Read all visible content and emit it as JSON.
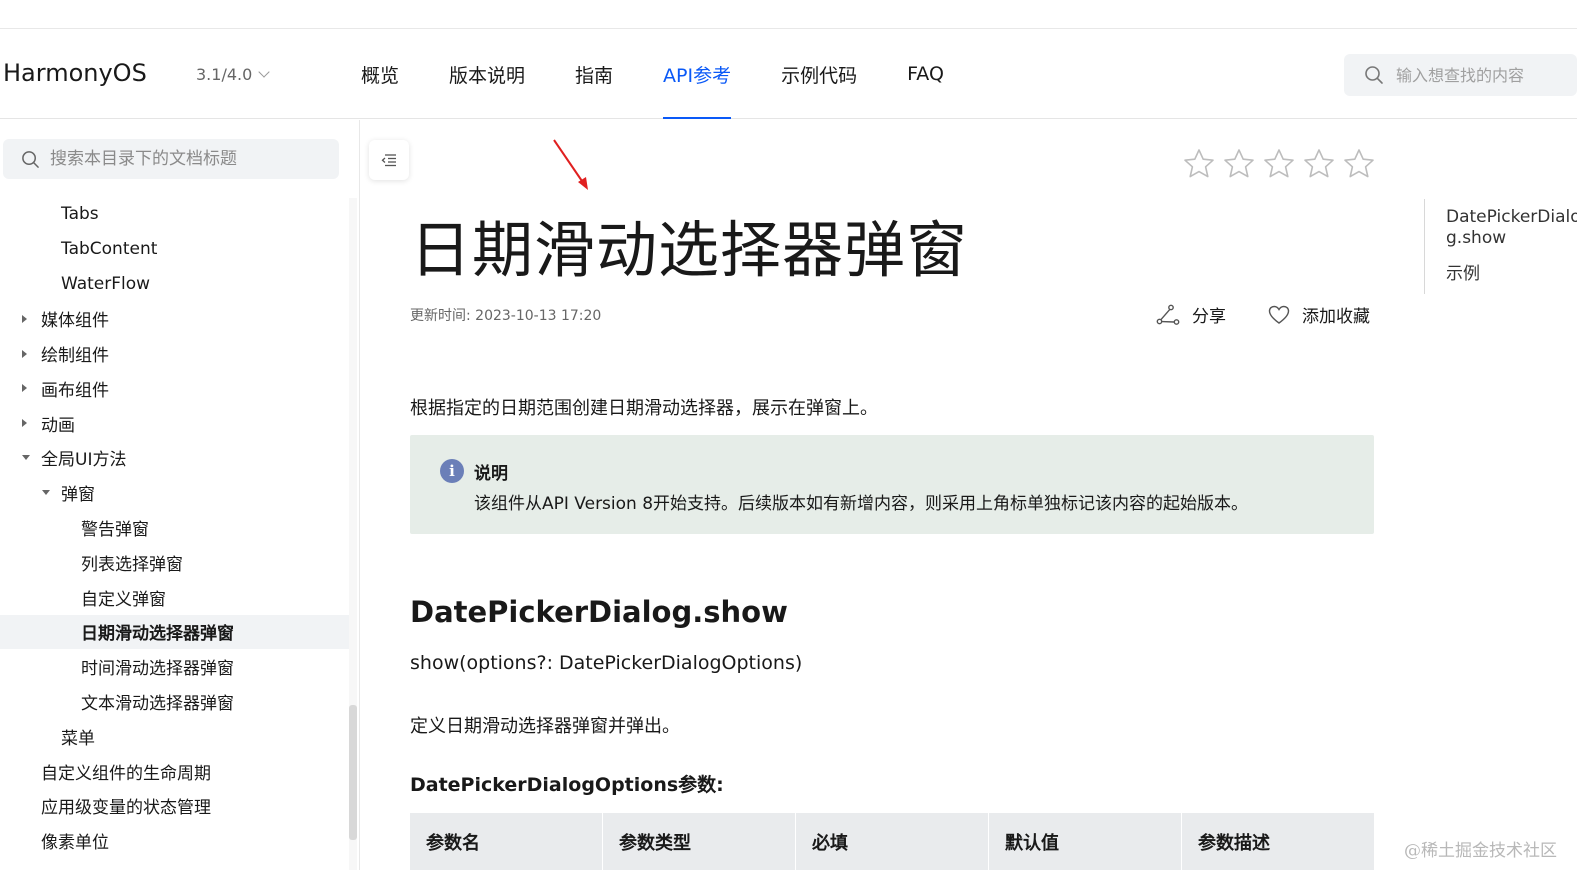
{
  "header": {
    "brand": "HarmonyOS",
    "version": "3.1/4.0",
    "nav": [
      "概览",
      "版本说明",
      "指南",
      "API参考",
      "示例代码",
      "FAQ"
    ],
    "active_nav": "API参考",
    "search_placeholder": "输入想查找的内容"
  },
  "sidebar": {
    "search_placeholder": "搜索本目录下的文档标题",
    "items": [
      {
        "label": "Tabs",
        "level": 2,
        "toggle": "none"
      },
      {
        "label": "TabContent",
        "level": 2,
        "toggle": "none"
      },
      {
        "label": "WaterFlow",
        "level": 2,
        "toggle": "none"
      },
      {
        "label": "媒体组件",
        "level": 1,
        "toggle": "collapsed"
      },
      {
        "label": "绘制组件",
        "level": 1,
        "toggle": "collapsed"
      },
      {
        "label": "画布组件",
        "level": 1,
        "toggle": "collapsed"
      },
      {
        "label": "动画",
        "level": 1,
        "toggle": "collapsed"
      },
      {
        "label": "全局UI方法",
        "level": 1,
        "toggle": "expanded"
      },
      {
        "label": "弹窗",
        "level": 2,
        "toggle": "expanded"
      },
      {
        "label": "警告弹窗",
        "level": 3,
        "toggle": "none"
      },
      {
        "label": "列表选择弹窗",
        "level": 3,
        "toggle": "none"
      },
      {
        "label": "自定义弹窗",
        "level": 3,
        "toggle": "none"
      },
      {
        "label": "日期滑动选择器弹窗",
        "level": 3,
        "toggle": "none",
        "active": true
      },
      {
        "label": "时间滑动选择器弹窗",
        "level": 3,
        "toggle": "none"
      },
      {
        "label": "文本滑动选择器弹窗",
        "level": 3,
        "toggle": "none"
      },
      {
        "label": "菜单",
        "level": 2,
        "toggle": "none"
      },
      {
        "label": "自定义组件的生命周期",
        "level": 1,
        "toggle": "none"
      },
      {
        "label": "应用级变量的状态管理",
        "level": 1,
        "toggle": "none"
      },
      {
        "label": "像素单位",
        "level": 1,
        "toggle": "none"
      }
    ]
  },
  "main": {
    "title": "日期滑动选择器弹窗",
    "updated": "更新时间: 2023-10-13 17:20",
    "share_label": "分享",
    "favorite_label": "添加收藏",
    "intro": "根据指定的日期范围创建日期滑动选择器，展示在弹窗上。",
    "note_title": "说明",
    "note_icon": "i",
    "note_text": "该组件从API Version 8开始支持。后续版本如有新增内容，则采用上角标单独标记该内容的起始版本。",
    "h2": "DatePickerDialog.show",
    "signature": "show(options?: DatePickerDialogOptions)",
    "description": "定义日期滑动选择器弹窗并弹出。",
    "h3": "DatePickerDialogOptions参数:",
    "table_headers": [
      "参数名",
      "参数类型",
      "必填",
      "默认值",
      "参数描述"
    ]
  },
  "toc": {
    "items": [
      "DatePickerDialog.show",
      "示例"
    ]
  },
  "rating": {
    "stars": 5,
    "filled": 0
  },
  "watermark": "@稀土掘金技术社区",
  "colors": {
    "accent": "#0a59f7",
    "note_bg": "#e6ede8",
    "arrow": "#e02020"
  }
}
